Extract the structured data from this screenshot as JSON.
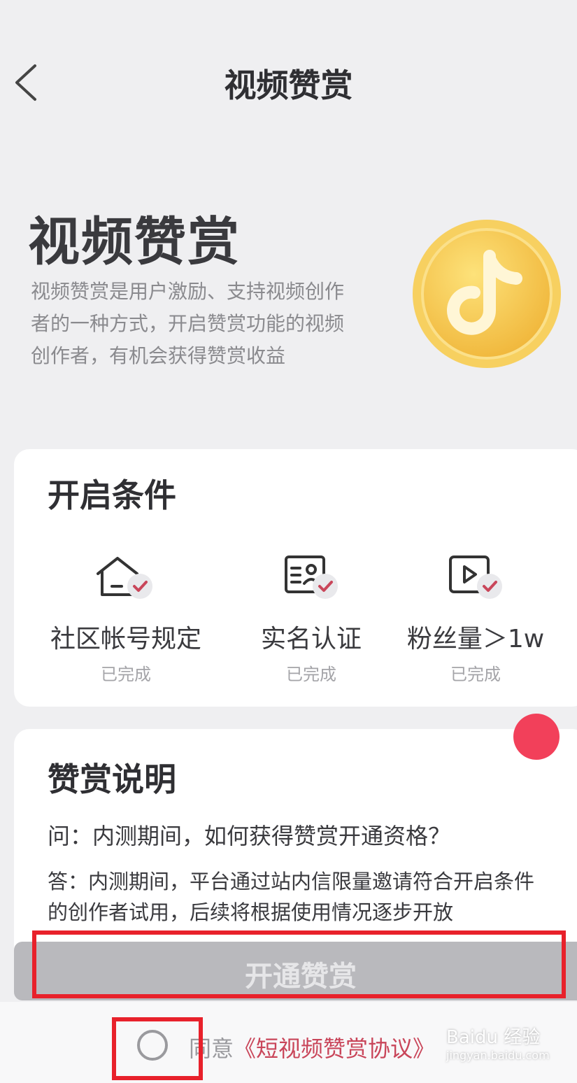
{
  "nav": {
    "title": "视频赞赏"
  },
  "hero": {
    "title": "视频赞赏",
    "description": "视频赞赏是用户激励、支持视频创作者的一种方式，开启赞赏功能的视频创作者，有机会获得赞赏收益"
  },
  "conditions": {
    "heading": "开启条件",
    "items": [
      {
        "icon": "home-check-icon",
        "label": "社区帐号规定",
        "status": "已完成"
      },
      {
        "icon": "id-card-check-icon",
        "label": "实名认证",
        "status": "已完成"
      },
      {
        "icon": "video-check-icon",
        "label": "粉丝量＞1w",
        "status": "已完成"
      }
    ]
  },
  "explain": {
    "heading": "赞赏说明",
    "question": "问：内测期间，如何获得赞赏开通资格？",
    "answer": "答：内测期间，平台通过站内信限量邀请符合开启条件的创作者试用，后续将根据使用情况逐步开放"
  },
  "action": {
    "button_label": "开通赞赏"
  },
  "agreement": {
    "prefix": "同意",
    "link": "《短视频赞赏协议》"
  },
  "watermark": {
    "brand": "Baidu 经验",
    "url": "jingyan.baidu.com"
  },
  "colors": {
    "accent_red": "#f2405a",
    "check_pink": "#c9465a",
    "coin_gold": "#f6c445",
    "highlight_box": "#e8212b"
  }
}
